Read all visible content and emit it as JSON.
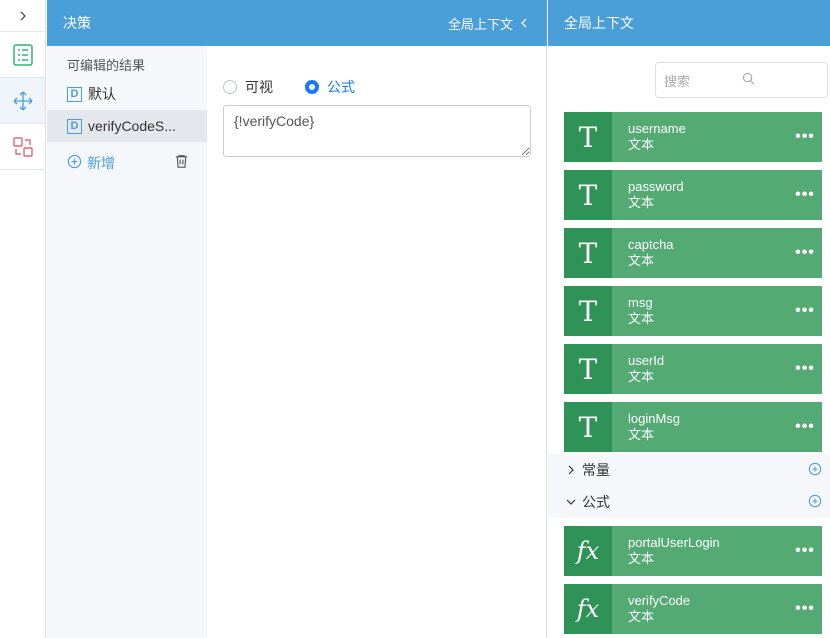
{
  "rail": {
    "items": [
      {
        "icon": "chevron-right-icon"
      },
      {
        "icon": "list-icon",
        "color": "#2fb37a"
      },
      {
        "icon": "move-arrows-icon",
        "color": "#4a9fd8"
      },
      {
        "icon": "swap-icon",
        "color": "#e0677a"
      }
    ]
  },
  "decision": {
    "title": "决策",
    "context_toggle": "全局上下文",
    "results_label": "可编辑的结果",
    "results": [
      {
        "badge": "D",
        "label": "默认"
      },
      {
        "badge": "D",
        "label": "verifyCodeS..."
      }
    ],
    "add_label": "新增"
  },
  "editor": {
    "mode_visual": "可视",
    "mode_formula": "公式",
    "selected_mode": "公式",
    "formula_value": "{!verifyCode}"
  },
  "context": {
    "title": "全局上下文",
    "search_placeholder": "搜索",
    "variables": [
      {
        "name": "username",
        "type": "文本",
        "glyph": "T"
      },
      {
        "name": "password",
        "type": "文本",
        "glyph": "T"
      },
      {
        "name": "captcha",
        "type": "文本",
        "glyph": "T"
      },
      {
        "name": "msg",
        "type": "文本",
        "glyph": "T"
      },
      {
        "name": "userId",
        "type": "文本",
        "glyph": "T"
      },
      {
        "name": "loginMsg",
        "type": "文本",
        "glyph": "T"
      }
    ],
    "constants_label": "常量",
    "formulas_label": "公式",
    "formulas": [
      {
        "name": "portalUserLogin",
        "type": "文本",
        "glyph": "fx"
      },
      {
        "name": "verifyCode",
        "type": "文本",
        "glyph": "fx"
      }
    ],
    "more_label": "•••"
  },
  "colors": {
    "header": "#4a9fd8",
    "card": "#53ab73",
    "card_glyph": "#2f9257",
    "radio_active": "#1677ff"
  }
}
